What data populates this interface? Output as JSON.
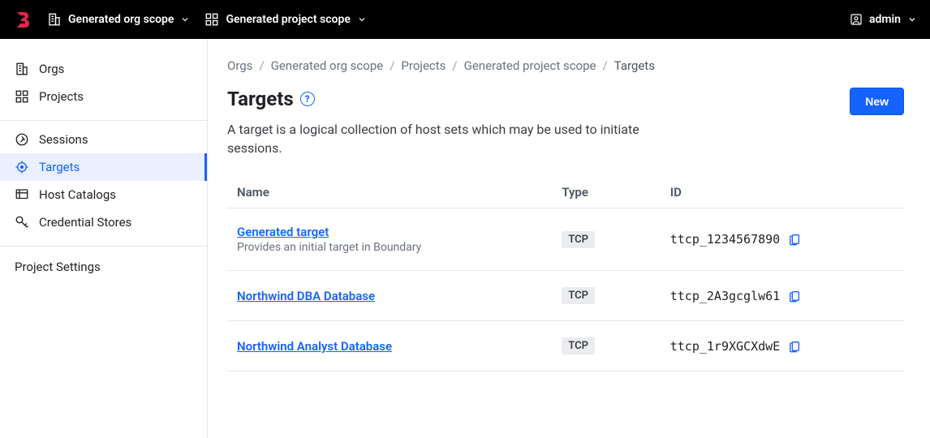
{
  "topbar": {
    "org_scope_label": "Generated org scope",
    "project_scope_label": "Generated project scope",
    "user_label": "admin"
  },
  "sidebar": {
    "top": [
      {
        "label": "Orgs",
        "icon": "org-icon"
      },
      {
        "label": "Projects",
        "icon": "projects-icon"
      }
    ],
    "project_nav": [
      {
        "label": "Sessions",
        "icon": "sessions-icon",
        "active": false
      },
      {
        "label": "Targets",
        "icon": "targets-icon",
        "active": true
      },
      {
        "label": "Host Catalogs",
        "icon": "host-catalogs-icon",
        "active": false
      },
      {
        "label": "Credential Stores",
        "icon": "credential-stores-icon",
        "active": false
      }
    ],
    "settings_label": "Project Settings"
  },
  "breadcrumb": {
    "items": [
      "Orgs",
      "Generated org scope",
      "Projects",
      "Generated project scope",
      "Targets"
    ]
  },
  "page": {
    "title": "Targets",
    "description": "A target is a logical collection of host sets which may be used to initiate sessions.",
    "new_button": "New"
  },
  "table": {
    "columns": {
      "name": "Name",
      "type": "Type",
      "id": "ID"
    },
    "rows": [
      {
        "name": "Generated target",
        "description": "Provides an initial target in Boundary",
        "type": "TCP",
        "id": "ttcp_1234567890"
      },
      {
        "name": "Northwind DBA Database",
        "description": "",
        "type": "TCP",
        "id": "ttcp_2A3gcglw61"
      },
      {
        "name": "Northwind Analyst Database",
        "description": "",
        "type": "TCP",
        "id": "ttcp_1r9XGCXdwE"
      }
    ]
  }
}
